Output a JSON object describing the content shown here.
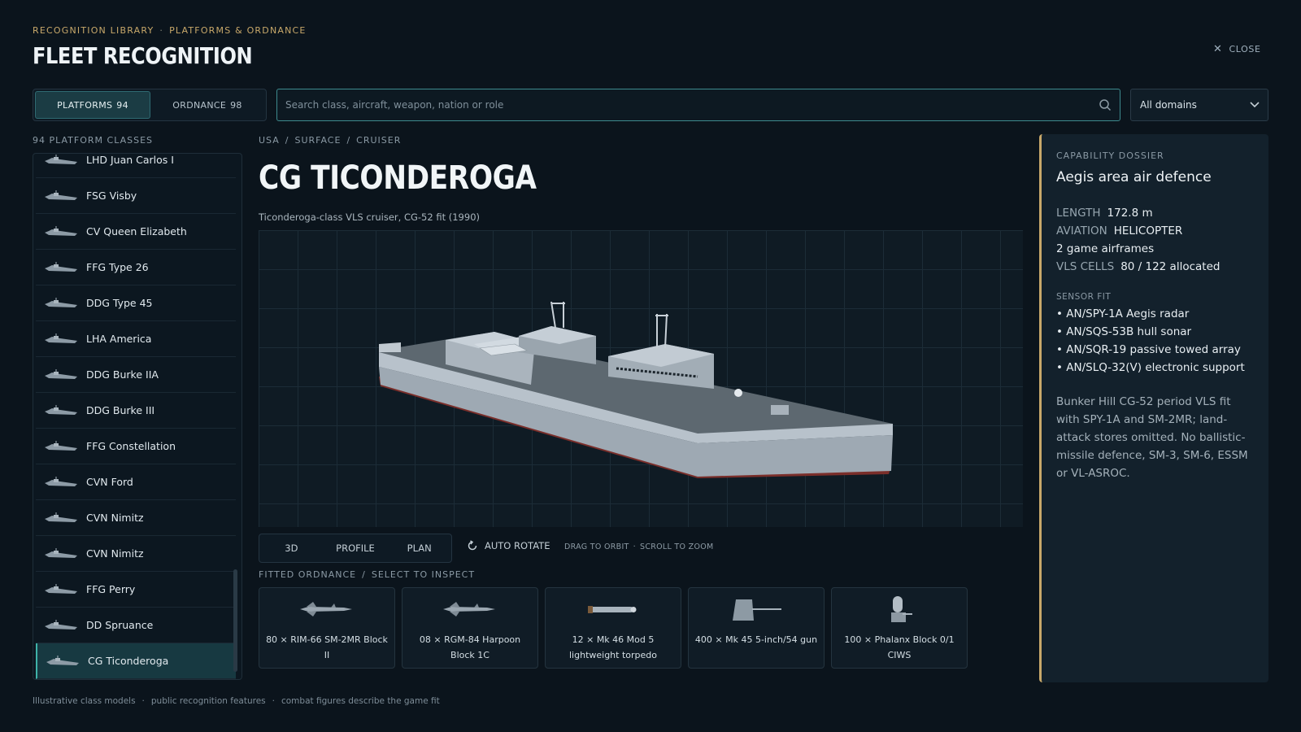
{
  "header": {
    "crumb_1": "RECOGNITION LIBRARY",
    "crumb_sep": "·",
    "crumb_2": "PLATFORMS & ORDNANCE",
    "title": "FLEET RECOGNITION",
    "close_label": "CLOSE"
  },
  "tabs": {
    "platforms_label": "PLATFORMS",
    "platforms_count": "94",
    "ordnance_label": "ORDNANCE",
    "ordnance_count": "98"
  },
  "search": {
    "placeholder": "Search class, aircraft, weapon, nation or role",
    "value": ""
  },
  "domain_filter": {
    "selected": "All domains"
  },
  "sidebar": {
    "count_label": "94 PLATFORM CLASSES",
    "items": [
      {
        "label": "LHD Juan Carlos I"
      },
      {
        "label": "FSG Visby"
      },
      {
        "label": "CV Queen Elizabeth"
      },
      {
        "label": "FFG Type 26"
      },
      {
        "label": "DDG Type 45"
      },
      {
        "label": "LHA America"
      },
      {
        "label": "DDG Burke IIA"
      },
      {
        "label": "DDG Burke III"
      },
      {
        "label": "FFG Constellation"
      },
      {
        "label": "CVN Ford"
      },
      {
        "label": "CVN Nimitz"
      },
      {
        "label": "CVN Nimitz"
      },
      {
        "label": "FFG Perry"
      },
      {
        "label": "DD Spruance"
      },
      {
        "label": "CG Ticonderoga"
      }
    ],
    "selected": "CG Ticonderoga"
  },
  "detail": {
    "bc_1": "USA",
    "bc_2": "SURFACE",
    "bc_3": "CRUISER",
    "bc_sep": "/",
    "title": "CG TICONDEROGA",
    "subtitle": "Ticonderoga-class VLS cruiser, CG-52 fit (1990)",
    "views": [
      "3D",
      "PROFILE",
      "PLAN"
    ],
    "auto_rotate": "AUTO ROTATE",
    "hint_1": "DRAG TO ORBIT",
    "hint_sep": "·",
    "hint_2": "SCROLL TO ZOOM",
    "ord_label_1": "FITTED ORDNANCE",
    "ord_label_2": "SELECT TO INSPECT",
    "ordnance": [
      {
        "label": "80 × RIM-66 SM-2MR Block II",
        "icon": "missile-icon"
      },
      {
        "label": "08 × RGM-84 Harpoon Block 1C",
        "icon": "missile-icon"
      },
      {
        "label": "12 × Mk 46 Mod 5 lightweight torpedo",
        "icon": "torpedo-icon"
      },
      {
        "label": "400 × Mk 45 5-inch/54 gun",
        "icon": "gun-icon"
      },
      {
        "label": "100 × Phalanx Block 0/1 CIWS",
        "icon": "ciws-icon"
      }
    ]
  },
  "dossier": {
    "caption": "CAPABILITY DOSSIER",
    "heading": "Aegis area air defence",
    "length_k": "LENGTH",
    "length_v": "172.8 m",
    "aviation_k": "AVIATION",
    "aviation_v": "HELICOPTER",
    "airframes": "2 game airframes",
    "vls_k": "VLS CELLS",
    "vls_v": "80 / 122 allocated",
    "sensor_caption": "SENSOR FIT",
    "sensors": [
      "• AN/SPY-1A Aegis radar",
      "• AN/SQS-53B hull sonar",
      "• AN/SQR-19 passive towed array",
      "• AN/SLQ-32(V) electronic support"
    ],
    "note": "Bunker Hill CG-52 period VLS fit with SPY-1A and SM-2MR; land-attack stores omitted. No ballistic-missile defence, SM-3, SM-6, ESSM or VL-ASROC."
  },
  "footer": {
    "f1": "Illustrative class models",
    "f2": "public recognition features",
    "f3": "combat figures describe the game fit",
    "sep": "·"
  },
  "colors": {
    "background": "#0b141c",
    "accent_teal": "#3fb3a9",
    "accent_gold": "#c8a86a",
    "hull_red": "#8a3530"
  }
}
